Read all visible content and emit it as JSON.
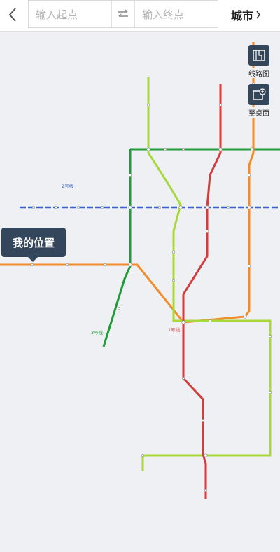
{
  "search": {
    "start_placeholder": "输入起点",
    "end_placeholder": "输入终点"
  },
  "header": {
    "city_label": "城市"
  },
  "tools": {
    "line_map_label": "线路图",
    "desktop_label": "至桌面"
  },
  "location": {
    "my_location_label": "我的位置"
  },
  "map": {
    "line_labels": {
      "line2": "2号线",
      "line3": "3号线",
      "line1": "1号线"
    },
    "line_colors": {
      "line1": "#d23c3c",
      "line2": "#3a5fd0",
      "line3": "#229a3a",
      "line4_orange": "#f28c2a",
      "line5_lightgreen": "#a8d83c"
    }
  },
  "icons": {
    "back": "chevron-left-icon",
    "swap": "swap-arrows-icon",
    "city_chevron": "chevron-right-icon",
    "line_map": "map-icon",
    "desktop": "add-to-desktop-icon"
  }
}
